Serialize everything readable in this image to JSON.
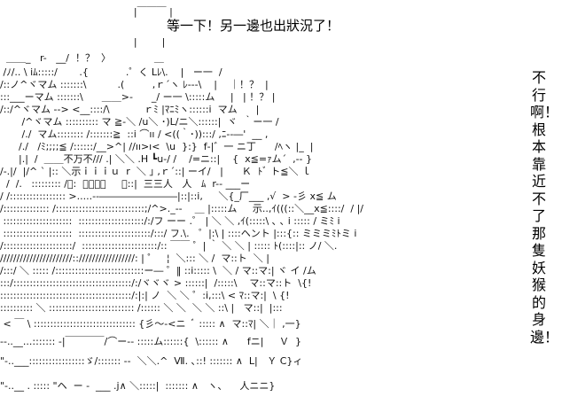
{
  "dialogue": {
    "top": "等一下！另一邊也出狀況了！",
    "side": "不行啊！根本靠近不了那隻妖猴的身邊！"
  },
  "art": {
    "lines": [
      "                      |￣￣￣ |",
      "                      |        |",
      "  ＿＿_   r-   __/  ！？  〉              ＿",
      " /ﾉ/.. \\ iﾑ:::::/       .{            .゜く Lﾚ\\.    |   ー一  /",
      "/::ノ^ヾマム :::::::\\          .(         ,ｒ´ヽ ﾚ---\\    |    ｜！？  |",
      ":::___ーマム :::::::\\      ＿＿>-      _/ ー一 \\:::::ム     |   | ！？ |",
      "/::/^ヾマム -‐> <__::::/\\           ｒﾐ |ﾏﾆﾐヽ::::::i  マム      |",
      "   /^ヾマム :::::::::: マ ≧-＼ /u＼ ･)L/ニ＼::::::|  ヾ  ｀ー一 /",
      "   /./  マム:::::::: /:::::::≧  ::i ⌒ıı / <((｀･)):::/ ,ﾆ--―'  __ ,",
      "  /./   /ﾐ;;;;≦ /::::::/__>^| //ıı>ı<  \\u  }:}  f‐|゛一 ニ丁      /ﾍヽ |_  |",
      "  |.|  /  ＿＿不万不/// .| ＼＼ .H ┗u-/ /    /=ニ::|    {  x≦=ｧム´  ,-‐ }",
      "/-.|/  |/^ ` |:: ＼示ｉｉｉｕ  r  ＼ ｣ ,ｒ´::| ーイ/   |      Ｋ  ﾄﾞ ト≦＼ ｌ",
      "  /  /.   ::::::::: /ﾞ:  ＼｜｜｜     ＼::|  三三人   人   ﾑ  r-- ___ー",
      "/ /::::::::::::::::: >.....-‐――――――――|::|::i,     ＼{_厂___ ,√  > ‐彡 x≦ ム",
      "/:::::::::::::: /:::::::::::::::::::::::::::;/^>._--    ＿ |:::::ム     示..,ｲ(((::＼__x≦::::/  / |/",
      " :::::::::::::::::::::  ::::::::::::::::::::/:/フ ーー .゜ | ＼ ＼ ,ｲ(:::::\\ ､ ､ i ::::: / ミﾐ i",
      " :::::::::::::::::::::  ::::::::::::::::::::::/:::/ フ.\\.   ゜|:\\ | ::::ヘント |:::{:: ミミミﾐﾄミ i",
      "/:::::::::::::::::::::/  :::::::::::::::::::::::/:: ￣￣ ゜| ｀ ＼ ＼ | ::::: ﾄ(::::|:: ノ/ ＼.",
      "//////////////////////:://///////////////: | ゜   ¦  ＼::: ＼ /  マ::ト  ＼ |",
      "/:::/ ＼ ::::: /:::::::::::::::::::::::::::ー― ゜‖ ::i::::: \\  ＼ / マ::マ:| ヾ イ /ム",
      ":::/::::::::::::::::::::::::::::::::::::/:/ヾヾヾ > ::::::|  /:::::\\    マ::マ::ト  \\{!",
      "::::::::::::::::::::::::::::::::::::::::/:|:| ノ  ＼ ＼ ゜:i,:::\\ < ﾏ::マ:|  \\ {!",
      ":::::::::: ＼ :::::::::::::::::::::::::: /:::::: ＼ ＼  ＼ ＼ ::\\ |   マ::|  |:::",
      " < ￣ \\ ::::::::::::::::::::::::::::::: {彡〜‐<ニ  ﾞ ::::: ∧  マ::ﾏ| ＼｜ ,一}",
      "‐-..__...::::::: ‐|￣￣￣￣/⌒ー-- :::::ム::::::{  \\:::::: ∧      fニ|     Ｖ  }",
      "\"‐..___:::::::::::::::::ゞ/::::::: ‐‐  ＼＼.^  Ⅶ. ､::! ::::::: ∧  L|   Ｙ C}ィ",
      "\"‐..__ . ::::: \"ヘ  ー ‐  ___ .j∧ ＼:::::|  ::::::: ∧   ヽ、    人ニニ}"
    ]
  }
}
